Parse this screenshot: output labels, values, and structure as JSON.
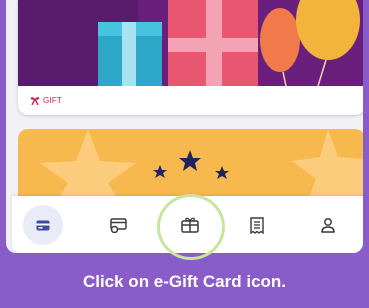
{
  "gift_card": {
    "label": "GIFT"
  },
  "nav": {
    "items": [
      {
        "name": "wallet",
        "icon": "card-icon",
        "active": true
      },
      {
        "name": "payments",
        "icon": "card-pay-icon",
        "active": false
      },
      {
        "name": "egift",
        "icon": "gift-icon",
        "active": false
      },
      {
        "name": "receipts",
        "icon": "receipt-icon",
        "active": false
      },
      {
        "name": "profile",
        "icon": "user-icon",
        "active": false
      }
    ]
  },
  "instruction": {
    "text": "Click on e-Gift Card icon."
  },
  "colors": {
    "frame": "#8a5cc9",
    "accent": "#3e4aa0",
    "highlight": "#c6e59f",
    "gift_label": "#d3214b",
    "card2_bg": "#f7b94e"
  }
}
